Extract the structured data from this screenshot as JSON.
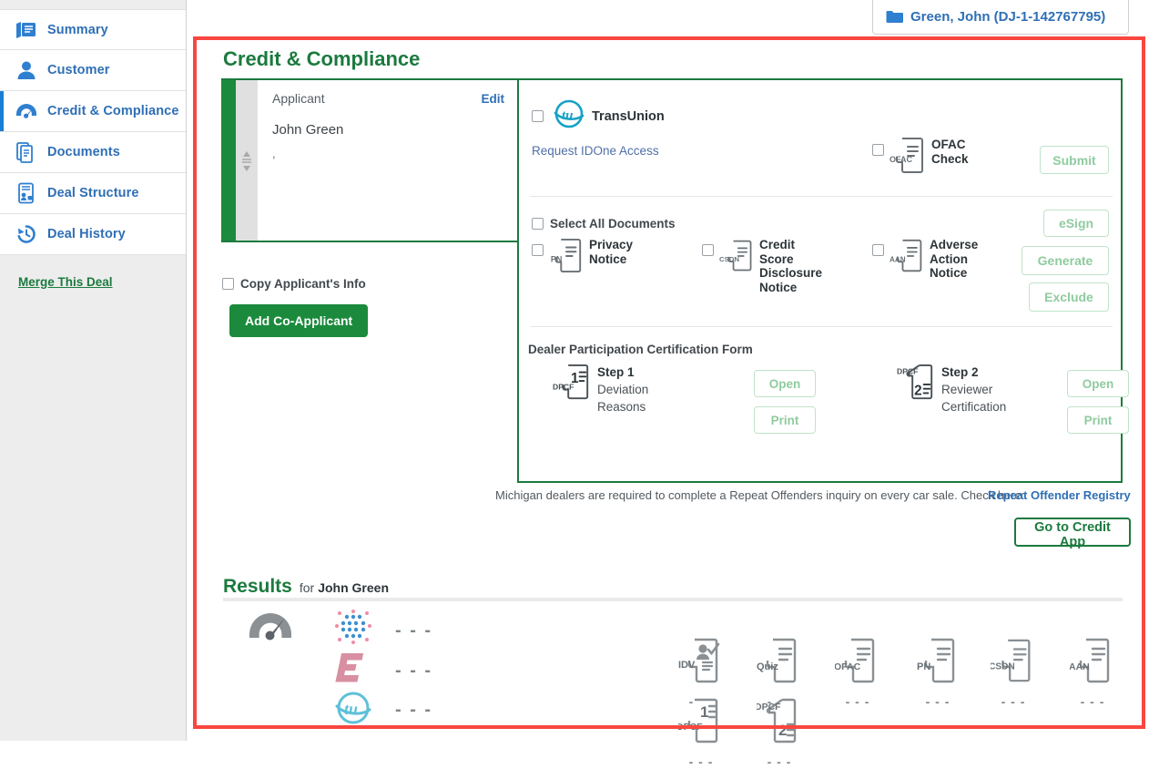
{
  "deal_chip": {
    "label": "Green, John (DJ-1-142767795)",
    "icon": "folder-icon"
  },
  "sidebar": {
    "items": [
      {
        "label": "Summary",
        "icon": "summary-icon",
        "active": false
      },
      {
        "label": "Customer",
        "icon": "person-icon",
        "active": false
      },
      {
        "label": "Credit & Compliance",
        "icon": "gauge-icon",
        "active": true
      },
      {
        "label": "Documents",
        "icon": "documents-icon",
        "active": false
      },
      {
        "label": "Deal Structure",
        "icon": "deal-structure-icon",
        "active": false
      },
      {
        "label": "Deal History",
        "icon": "history-icon",
        "active": false
      }
    ],
    "merge_link": "Merge This Deal"
  },
  "page": {
    "title": "Credit & Compliance"
  },
  "applicant": {
    "heading": "Applicant",
    "edit_label": "Edit",
    "name": "John Green",
    "address": ","
  },
  "copy_applicant": {
    "label": "Copy Applicant's Info",
    "checked": false
  },
  "add_co_applicant": {
    "label": "Add Co-Applicant"
  },
  "transunion": {
    "name": "TransUnion",
    "checked": false,
    "idone_link": "Request IDOne Access"
  },
  "ofac": {
    "checked": false,
    "icon_tag": "OFAC",
    "line1": "OFAC",
    "line2": "Check",
    "submit_label": "Submit"
  },
  "documents": {
    "select_all_label": "Select All Documents",
    "select_all_checked": false,
    "items": [
      {
        "tag": "PN",
        "line1": "Privacy",
        "line2": "Notice",
        "line3": "",
        "line4": "",
        "checked": false
      },
      {
        "tag": "CSDN",
        "line1": "Credit",
        "line2": "Score",
        "line3": "Disclosure",
        "line4": "Notice",
        "checked": false
      },
      {
        "tag": "AAN",
        "line1": "Adverse",
        "line2": "Action",
        "line3": "Notice",
        "line4": "",
        "checked": false
      }
    ],
    "buttons": {
      "esign": "eSign",
      "generate": "Generate",
      "exclude": "Exclude"
    }
  },
  "dpcf": {
    "title": "Dealer Participation Certification Form",
    "steps": [
      {
        "icon_number": "1",
        "icon_tag": "DPCF",
        "tag_position": "bottom",
        "title": "Step 1",
        "sub1": "Deviation",
        "sub2": "Reasons",
        "open_label": "Open",
        "print_label": "Print"
      },
      {
        "icon_number": "2",
        "icon_tag": "DPCF",
        "tag_position": "top",
        "title": "Step 2",
        "sub1": "Reviewer",
        "sub2": "Certification",
        "open_label": "Open",
        "print_label": "Print"
      }
    ]
  },
  "michigan": {
    "note": "Michigan dealers are required to complete a Repeat Offenders inquiry on every car sale. Check here:",
    "registry_link": "Repeat Offender Registry"
  },
  "credit_app_button": {
    "label": "Go to Credit App"
  },
  "results": {
    "title": "Results",
    "for_word": "for",
    "name": "John Green",
    "bureaus": [
      {
        "name": "experian-dots-logo",
        "value": "- - -"
      },
      {
        "name": "equifax-logo",
        "value": "- - -"
      },
      {
        "name": "transunion-logo",
        "value": "- - -"
      }
    ],
    "docs": [
      {
        "tag": "IDV",
        "value": "- - -",
        "type": "idv"
      },
      {
        "tag": "Quiz",
        "value": "- - -",
        "type": "plain"
      },
      {
        "tag": "OFAC",
        "value": "- - -",
        "type": "plain"
      },
      {
        "tag": "PN",
        "value": "- - -",
        "type": "plain"
      },
      {
        "tag": "CSDN",
        "value": "- - -",
        "type": "plain"
      },
      {
        "tag": "AAN",
        "value": "- - -",
        "type": "plain"
      },
      {
        "tag": "DPCF",
        "value": "- - -",
        "type": "num1"
      },
      {
        "tag": "DPCF",
        "value": "- - -",
        "type": "num2"
      }
    ]
  },
  "colors": {
    "brand_green": "#1b7a3e",
    "brand_blue": "#2f6fb5",
    "highlight_red": "#f9463f",
    "ghost_green": "#8fcb9f"
  }
}
